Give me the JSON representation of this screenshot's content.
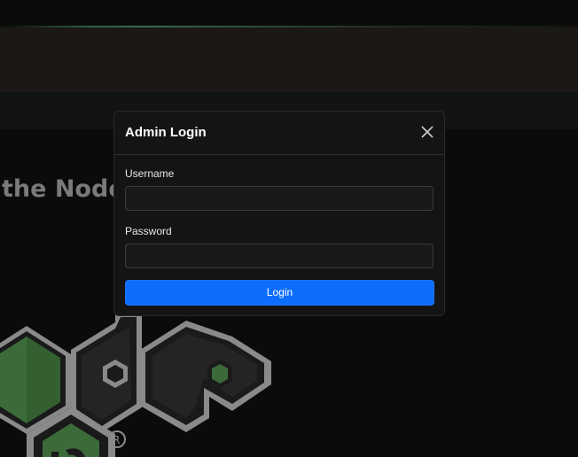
{
  "background": {
    "hero_title": "the Node"
  },
  "modal": {
    "title": "Admin Login",
    "username_label": "Username",
    "username_value": "",
    "password_label": "Password",
    "password_value": "",
    "login_label": "Login",
    "close_icon": "close-icon"
  },
  "colors": {
    "page_bg": "#0b0b0b",
    "header_bg": "#1b1816",
    "subnav_bg": "#111413",
    "modal_bg": "#141414",
    "primary_button": "#0d6efd",
    "node_green": "#3c6b3a",
    "node_gray": "#8a8a8a"
  }
}
